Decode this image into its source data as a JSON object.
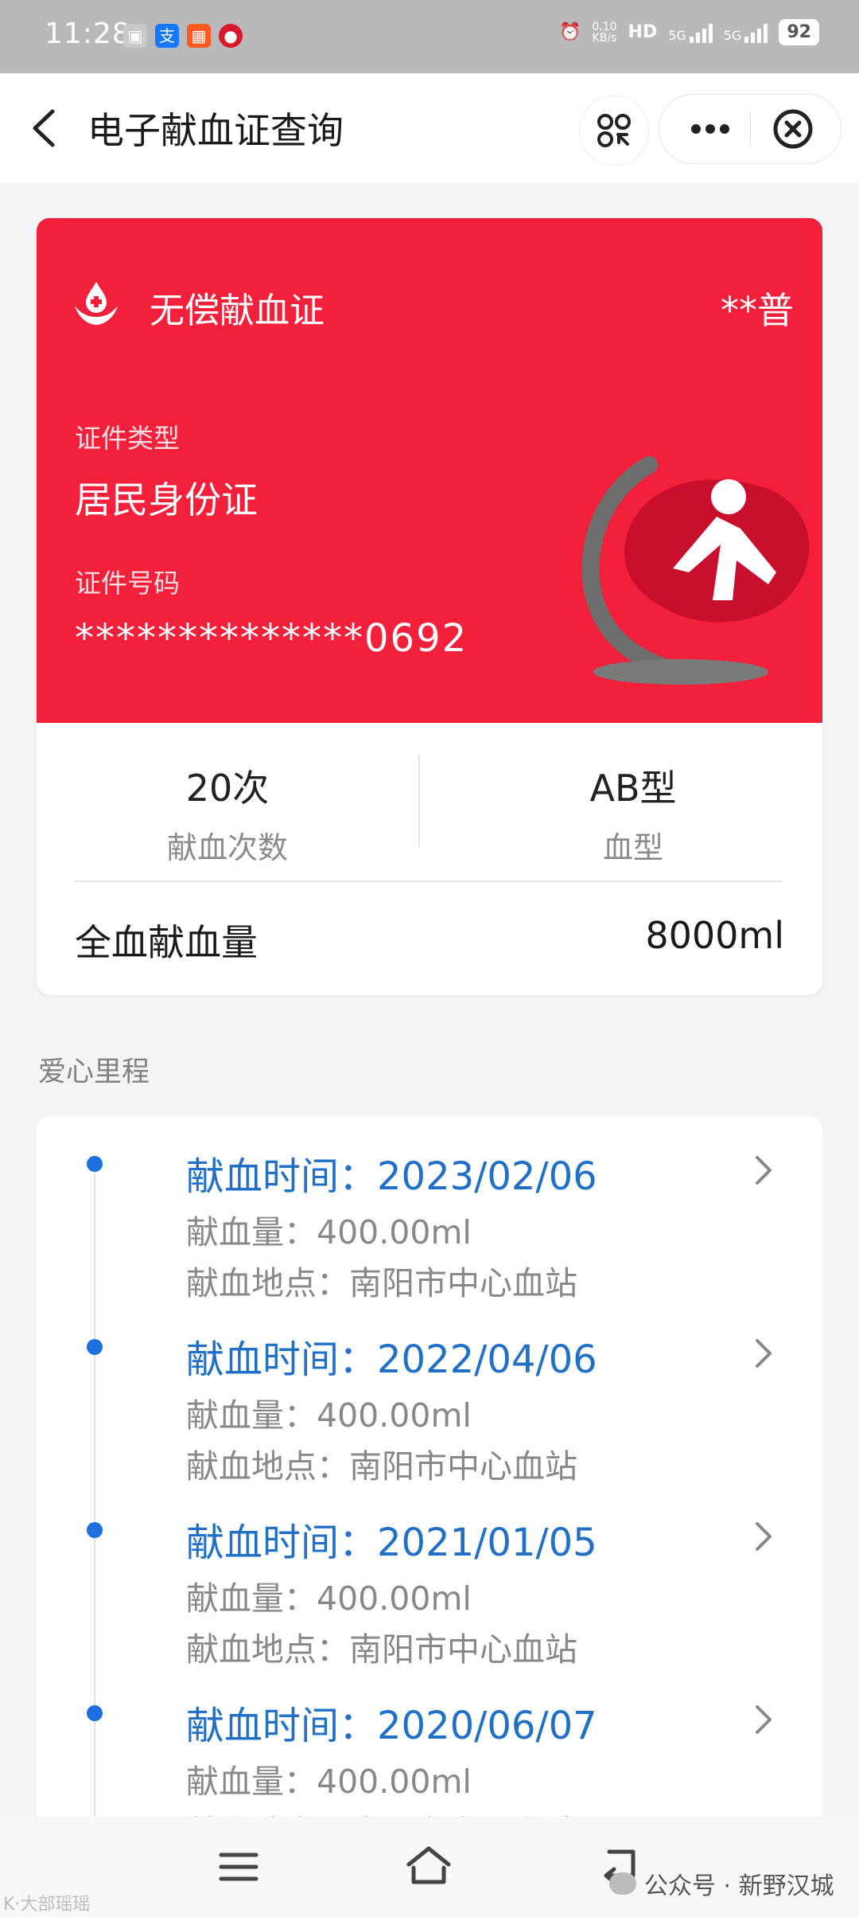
{
  "status_bar": {
    "time": "11:28",
    "net_speed_value": "0.10",
    "net_speed_unit": "KB/s",
    "hd": "HD",
    "sig1": "5G",
    "sig2": "5G",
    "battery": "92"
  },
  "nav": {
    "title": "电子献血证查询"
  },
  "card": {
    "title": "无偿献血证",
    "holder_name": "**普",
    "id_type_label": "证件类型",
    "id_type": "居民身份证",
    "id_number_label": "证件号码",
    "id_number": "**************0692"
  },
  "stats": {
    "donation_count": "20次",
    "donation_count_label": "献血次数",
    "blood_type": "AB型",
    "blood_type_label": "血型",
    "total_label": "全血献血量",
    "total_value": "8000ml"
  },
  "section_title": "爱心里程",
  "records": [
    {
      "time": "献血时间：2023/02/06",
      "amount": "献血量：400.00ml",
      "place": "献血地点：南阳市中心血站"
    },
    {
      "time": "献血时间：2022/04/06",
      "amount": "献血量：400.00ml",
      "place": "献血地点：南阳市中心血站"
    },
    {
      "time": "献血时间：2021/01/05",
      "amount": "献血量：400.00ml",
      "place": "献血地点：南阳市中心血站"
    },
    {
      "time": "献血时间：2020/06/07",
      "amount": "献血量：400.00ml",
      "place": "献血地点：南阳市中心血站"
    }
  ],
  "watermark": {
    "right": "公众号 · 新野汉城",
    "left": "K·大部瑶瑶"
  },
  "colors": {
    "card_red": "#f2203a",
    "timeline_blue": "#2070c8",
    "dot_blue": "#1e6fe0"
  }
}
